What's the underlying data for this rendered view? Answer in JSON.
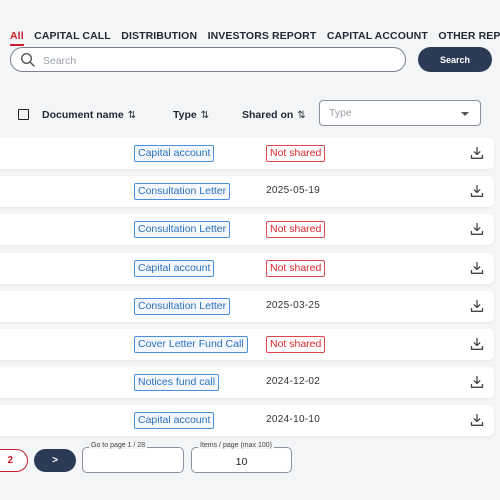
{
  "tabs": [
    "All",
    "CAPITAL CALL",
    "DISTRIBUTION",
    "INVESTORS REPORT",
    "CAPITAL ACCOUNT",
    "OTHER REPORTS"
  ],
  "active_tab": "All",
  "search": {
    "placeholder": "Search",
    "button_label": "Search"
  },
  "table": {
    "headers": {
      "document_name": "Document name",
      "type": "Type",
      "shared_on": "Shared on"
    },
    "sort_symbol": "⇅",
    "type_filter_placeholder": "Type",
    "rows": [
      {
        "type": "Capital account",
        "shared": "Not shared"
      },
      {
        "type": "Consultation Letter",
        "shared": "2025-05-19"
      },
      {
        "type": "Consultation Letter",
        "shared": "Not shared"
      },
      {
        "type": "Capital account",
        "shared": "Not shared"
      },
      {
        "type": "Consultation Letter",
        "shared": "2025-03-25"
      },
      {
        "type": "Cover Letter Fund Call",
        "shared": "Not shared"
      },
      {
        "type": "Notices fund call",
        "shared": "2024-12-02"
      },
      {
        "type": "Capital account",
        "shared": "2024-10-10"
      }
    ]
  },
  "pagination": {
    "current_page": "2",
    "next_label": ">",
    "goto_label": "Go to page 1 / 28",
    "goto_value": "",
    "items_label": "Items / page (max 100)",
    "items_value": "10"
  },
  "colors": {
    "accent_red": "#c8202f",
    "navy": "#2b3a55",
    "badge_blue": "#4a8fd8"
  },
  "icons": {
    "search": "search-icon",
    "download": "download-icon"
  }
}
